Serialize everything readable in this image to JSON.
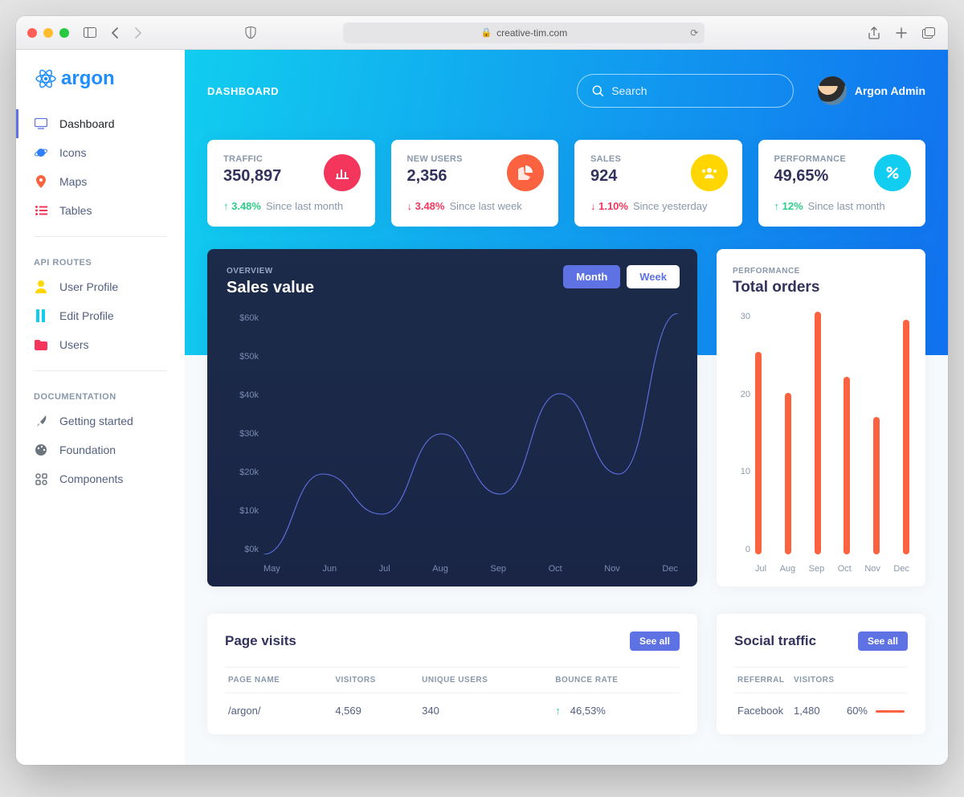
{
  "browser": {
    "url": "creative-tim.com"
  },
  "brand": "argon",
  "header": {
    "title": "DASHBOARD",
    "search_placeholder": "Search",
    "user_name": "Argon Admin"
  },
  "sidebar": {
    "items": [
      {
        "icon": "tv-icon",
        "color": "#5e72e4",
        "label": "Dashboard",
        "active": true
      },
      {
        "icon": "planet-icon",
        "color": "#2f80ff",
        "label": "Icons"
      },
      {
        "icon": "pin-icon",
        "color": "#fb6340",
        "label": "Maps"
      },
      {
        "icon": "list-icon",
        "color": "#f5365c",
        "label": "Tables"
      }
    ],
    "sections": [
      {
        "title": "API ROUTES",
        "items": [
          {
            "icon": "user-icon",
            "color": "#ffd600",
            "label": "User Profile"
          },
          {
            "icon": "edit-icon",
            "color": "#11cdef",
            "label": "Edit Profile"
          },
          {
            "icon": "folder-icon",
            "color": "#f5365c",
            "label": "Users"
          }
        ]
      },
      {
        "title": "DOCUMENTATION",
        "items": [
          {
            "icon": "rocket-icon",
            "color": "#6c757d",
            "label": "Getting started"
          },
          {
            "icon": "palette-icon",
            "color": "#6c757d",
            "label": "Foundation"
          },
          {
            "icon": "components-icon",
            "color": "#6c757d",
            "label": "Components"
          }
        ]
      }
    ]
  },
  "stats": [
    {
      "label": "TRAFFIC",
      "value": "350,897",
      "delta": "3.48%",
      "dir": "up",
      "since": "Since last month",
      "icon": "chart-bar-icon",
      "bg": "bg-red"
    },
    {
      "label": "NEW USERS",
      "value": "2,356",
      "delta": "3.48%",
      "dir": "down",
      "since": "Since last week",
      "icon": "pie-icon",
      "bg": "bg-orange"
    },
    {
      "label": "SALES",
      "value": "924",
      "delta": "1.10%",
      "dir": "down",
      "since": "Since yesterday",
      "icon": "users-icon",
      "bg": "bg-yellow"
    },
    {
      "label": "PERFORMANCE",
      "value": "49,65%",
      "delta": "12%",
      "dir": "up",
      "since": "Since last month",
      "icon": "percent-icon",
      "bg": "bg-teal"
    }
  ],
  "sales_chart": {
    "overline": "OVERVIEW",
    "title": "Sales value",
    "tabs": [
      "Month",
      "Week"
    ],
    "active_tab": "Month"
  },
  "orders_chart": {
    "overline": "PERFORMANCE",
    "title": "Total orders"
  },
  "page_visits": {
    "title": "Page visits",
    "see_all": "See all",
    "columns": [
      "PAGE NAME",
      "VISITORS",
      "UNIQUE USERS",
      "BOUNCE RATE"
    ],
    "rows": [
      {
        "page": "/argon/",
        "visitors": "4,569",
        "unique": "340",
        "dir": "up",
        "bounce": "46,53%"
      }
    ]
  },
  "social": {
    "title": "Social traffic",
    "see_all": "See all",
    "columns": [
      "REFERRAL",
      "VISITORS",
      ""
    ],
    "rows": [
      {
        "referral": "Facebook",
        "visitors": "1,480",
        "pct": "60%"
      }
    ]
  },
  "chart_data": [
    {
      "id": "sales_value",
      "type": "line",
      "title": "Sales value",
      "xlabel": "",
      "ylabel": "",
      "ylim": [
        0,
        60
      ],
      "y_ticks": [
        "$60k",
        "$50k",
        "$40k",
        "$30k",
        "$20k",
        "$10k",
        "$0k"
      ],
      "categories": [
        "May",
        "Jun",
        "Jul",
        "Aug",
        "Sep",
        "Oct",
        "Nov",
        "Dec"
      ],
      "values": [
        0,
        20,
        10,
        30,
        15,
        40,
        20,
        60
      ]
    },
    {
      "id": "total_orders",
      "type": "bar",
      "title": "Total orders",
      "xlabel": "",
      "ylabel": "",
      "ylim": [
        0,
        30
      ],
      "y_ticks": [
        "30",
        "20",
        "10",
        "0"
      ],
      "categories": [
        "Jul",
        "Aug",
        "Sep",
        "Oct",
        "Nov",
        "Dec"
      ],
      "values": [
        25,
        20,
        30,
        22,
        17,
        29
      ]
    }
  ]
}
